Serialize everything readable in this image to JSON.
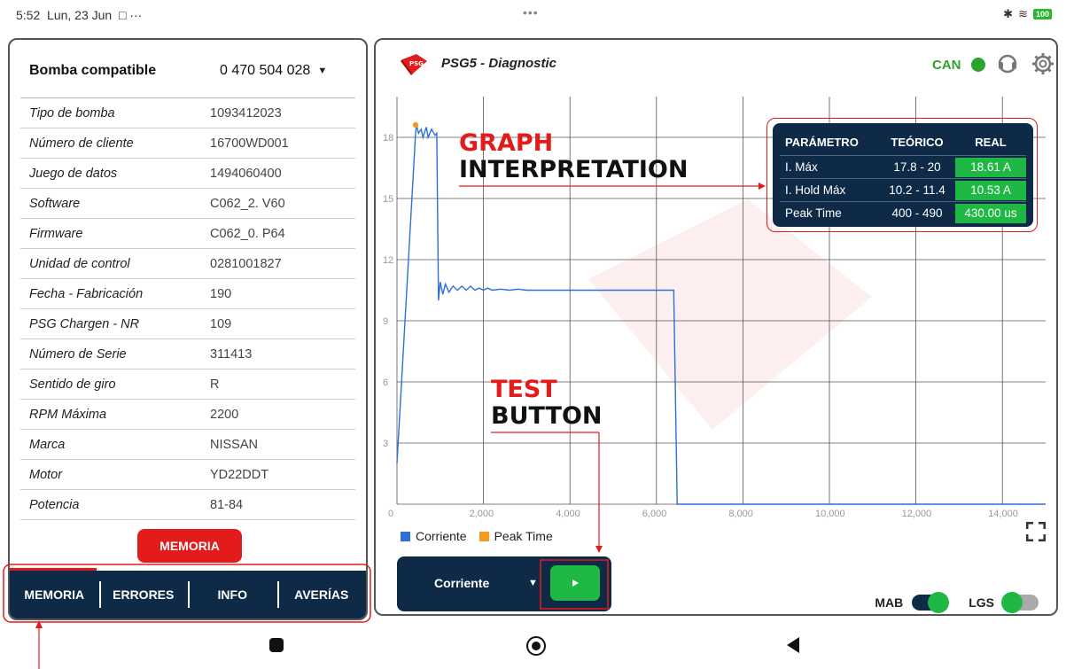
{
  "status": {
    "time": "5:52",
    "date": "Lun, 23 Jun",
    "icons": "□ ···",
    "center": "•••",
    "battery": "100"
  },
  "left": {
    "header_title": "Bomba compatible",
    "header_value": "0 470 504 028",
    "rows": [
      {
        "k": "Tipo de bomba",
        "v": "1093412023"
      },
      {
        "k": "Número de cliente",
        "v": "16700WD001"
      },
      {
        "k": "Juego de datos",
        "v": "1494060400"
      },
      {
        "k": "Software",
        "v": "C062_2. V60"
      },
      {
        "k": "Firmware",
        "v": "C062_0. P64"
      },
      {
        "k": "Unidad de control",
        "v": "0281001827"
      },
      {
        "k": "Fecha - Fabricación",
        "v": "190"
      },
      {
        "k": "PSG Chargen - NR",
        "v": "109"
      },
      {
        "k": "Número de Serie",
        "v": "311413"
      },
      {
        "k": "Sentido de giro",
        "v": "R"
      },
      {
        "k": "RPM Máxima",
        "v": "2200"
      },
      {
        "k": "Marca",
        "v": "NISSAN"
      },
      {
        "k": "Motor",
        "v": "YD22DDT"
      },
      {
        "k": "Potencia",
        "v": "81-84"
      }
    ],
    "memoria_button": "MEMORIA",
    "tabs": [
      "MEMORIA",
      "ERRORES",
      "INFO",
      "AVERÍAS"
    ]
  },
  "right": {
    "title": "PSG5 - Diagnostic",
    "can_label": "CAN",
    "select_label": "Corriente",
    "toggle1_label": "MAB",
    "toggle2_label": "LGS",
    "toggle1_on": true,
    "toggle2_on": false
  },
  "table": {
    "headers": [
      "PARÁMETRO",
      "TEÓRICO",
      "REAL"
    ],
    "rows": [
      {
        "p": "I. Máx",
        "t": "17.8 - 20",
        "r": "18.61 A"
      },
      {
        "p": "I. Hold Máx",
        "t": "10.2 - 11.4",
        "r": "10.53 A"
      },
      {
        "p": "Peak Time",
        "t": "400 - 490",
        "r": "430.00 us"
      }
    ]
  },
  "annotations": {
    "graph_red": "GRAPH",
    "graph_black": "INTERPRETATION",
    "test_red": "TEST",
    "test_black": "BUTTON"
  },
  "colors": {
    "navy": "#0f2a47",
    "red": "#e41b1b",
    "green": "#1fb845",
    "line": "#2f6fd6",
    "peak": "#f59a1e"
  },
  "chart_data": {
    "type": "line",
    "xlim": [
      0,
      15000
    ],
    "ylim": [
      0,
      20
    ],
    "xticks": [
      "0",
      "2,000",
      "4,000",
      "6,000",
      "8,000",
      "10,000",
      "12,000",
      "14,000"
    ],
    "xtick_values": [
      0,
      2000,
      4000,
      6000,
      8000,
      10000,
      12000,
      14000
    ],
    "yticks": [
      "3",
      "6",
      "9",
      "12",
      "15",
      "18"
    ],
    "ytick_values": [
      3,
      6,
      9,
      12,
      15,
      18
    ],
    "legend": [
      "Corriente",
      "Peak Time"
    ],
    "series": [
      {
        "name": "Corriente",
        "x": [
          0,
          430,
          450,
          500,
          560,
          600,
          680,
          720,
          800,
          880,
          920,
          960,
          1000,
          1060,
          1120,
          1200,
          1300,
          1400,
          1500,
          1600,
          1700,
          1800,
          1900,
          2000,
          2100,
          2200,
          2400,
          2600,
          2800,
          3000,
          4000,
          5000,
          6000,
          6400,
          6480,
          6520,
          15000
        ],
        "y": [
          2.0,
          18.2,
          18.61,
          18.2,
          18.4,
          18.0,
          18.5,
          18.0,
          18.4,
          18.1,
          18.2,
          10.0,
          10.9,
          10.3,
          10.8,
          10.4,
          10.7,
          10.5,
          10.7,
          10.5,
          10.7,
          10.5,
          10.6,
          10.5,
          10.6,
          10.5,
          10.55,
          10.5,
          10.55,
          10.5,
          10.5,
          10.5,
          10.5,
          10.5,
          0.0,
          0.0,
          0.0
        ]
      },
      {
        "name": "Peak Time",
        "x": [
          430
        ],
        "y": [
          18.61
        ]
      }
    ]
  }
}
